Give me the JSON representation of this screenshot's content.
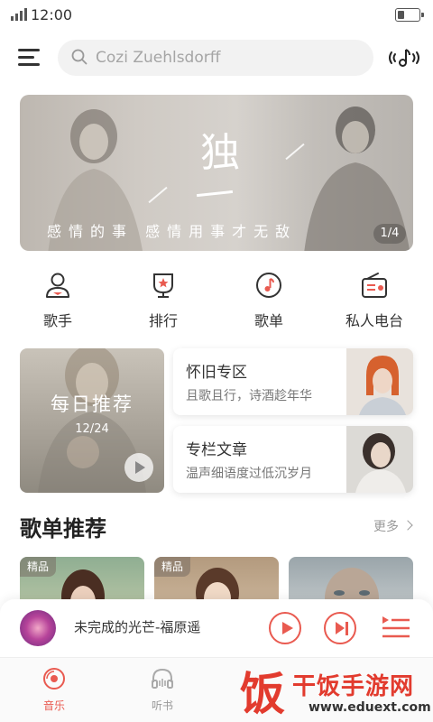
{
  "status_bar": {
    "time": "12:00",
    "battery_level": 0.25
  },
  "header": {
    "menu_icon": "hamburger-menu-icon",
    "search_placeholder": "Cozi Zuehlsdorff",
    "music_recognition_icon": "music-recognition-icon"
  },
  "banner": {
    "title_char": "独",
    "caption": "感情的事 感情用事才无敌",
    "pager": "1/4"
  },
  "categories": [
    {
      "label": "歌手",
      "icon": "singer-icon"
    },
    {
      "label": "排行",
      "icon": "ranking-icon"
    },
    {
      "label": "歌单",
      "icon": "playlist-icon"
    },
    {
      "label": "私人电台",
      "icon": "radio-icon"
    }
  ],
  "daily": {
    "title": "每日推荐",
    "date": "12/24"
  },
  "features": [
    {
      "title": "怀旧专区",
      "subtitle": "且歌且行，诗酒趁年华"
    },
    {
      "title": "专栏文章",
      "subtitle": "温声细语度过低沉岁月"
    }
  ],
  "playlist_section": {
    "title": "歌单推荐",
    "more": "更多",
    "items": [
      {
        "badge": "精品"
      },
      {
        "badge": "精品"
      },
      {
        "badge": ""
      }
    ]
  },
  "player": {
    "song": "未完成的光芒-福原遥"
  },
  "tabs": [
    {
      "label": "音乐",
      "icon": "music-disc-icon",
      "active": true
    },
    {
      "label": "听书",
      "icon": "headphones-icon",
      "active": false
    }
  ],
  "watermark": {
    "name": "干饭手游网",
    "url": "www.eduext.com",
    "logo_char": "饭"
  },
  "colors": {
    "accent": "#e95a50",
    "text": "#333333",
    "muted": "#999999"
  }
}
